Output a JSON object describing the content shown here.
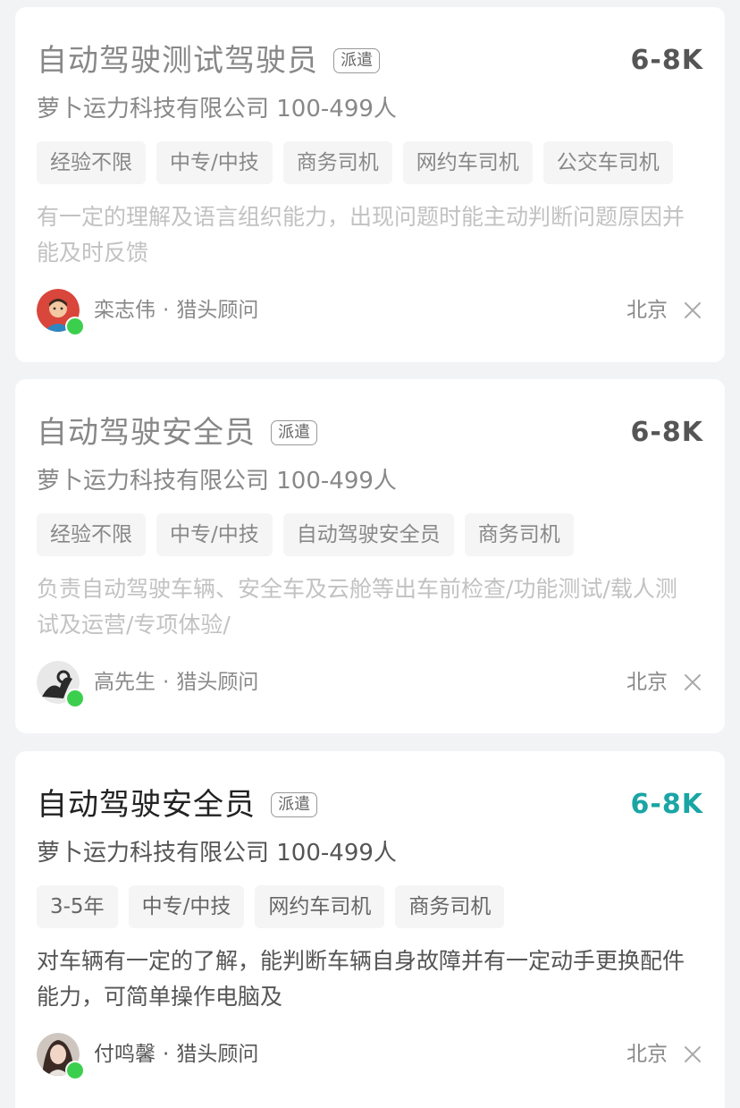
{
  "cards": [
    {
      "title": "自动驾驶测试驾驶员",
      "badge": "派遣",
      "salary": "6-8K",
      "company": "萝卜运力科技有限公司 100-499人",
      "tags": [
        "经验不限",
        "中专/中技",
        "商务司机",
        "网约车司机",
        "公交车司机"
      ],
      "desc": "有一定的理解及语言组织能力，出现问题时能主动判断问题原因并能及时反馈",
      "recruiter_name": "栾志伟",
      "recruiter_role": "猎头顾问",
      "separator": "·",
      "city": "北京",
      "avatar_icon": "avatar-man-cartoon"
    },
    {
      "title": "自动驾驶安全员",
      "badge": "派遣",
      "salary": "6-8K",
      "company": "萝卜运力科技有限公司 100-499人",
      "tags": [
        "经验不限",
        "中专/中技",
        "自动驾驶安全员",
        "商务司机"
      ],
      "desc": "负责自动驾驶车辆、安全车及云舱等出车前检查/功能测试/载人测试及运营/专项体验/",
      "recruiter_name": "高先生",
      "recruiter_role": "猎头顾问",
      "separator": "·",
      "city": "北京",
      "avatar_icon": "avatar-hand-photo"
    },
    {
      "title": "自动驾驶安全员",
      "badge": "派遣",
      "salary": "6-8K",
      "company": "萝卜运力科技有限公司 100-499人",
      "tags": [
        "3-5年",
        "中专/中技",
        "网约车司机",
        "商务司机"
      ],
      "desc": "对车辆有一定的了解，能判断车辆自身故障并有一定动手更换配件能力，可简单操作电脑及",
      "recruiter_name": "付鸣馨",
      "recruiter_role": "猎头顾问",
      "separator": "·",
      "city": "北京",
      "avatar_icon": "avatar-woman-photo"
    }
  ],
  "colors": {
    "salary_accent": "#1aa5a5",
    "online_dot": "#3ccf4e",
    "background": "#f2f3f5"
  }
}
